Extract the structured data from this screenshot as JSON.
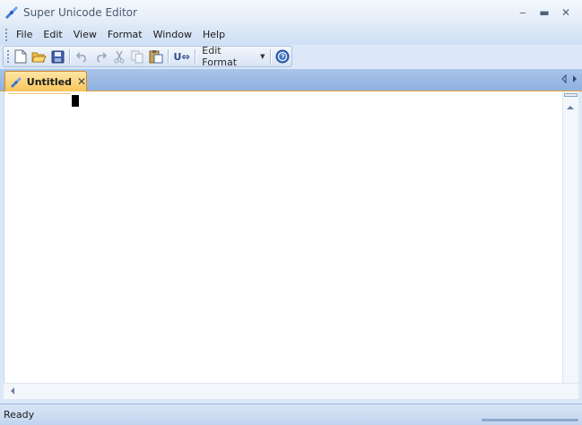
{
  "window": {
    "title": "Super Unicode Editor",
    "minimize_glyph": "‒",
    "maximize_glyph": "▬",
    "close_glyph": "✕"
  },
  "menu": {
    "items": [
      "File",
      "Edit",
      "View",
      "Format",
      "Window",
      "Help"
    ]
  },
  "toolbar": {
    "buttons": [
      "new-document-icon",
      "open-folder-icon",
      "save-icon",
      "undo-icon",
      "redo-icon",
      "cut-icon",
      "copy-icon",
      "paste-icon",
      "unicode-convert-icon",
      "help-icon"
    ],
    "unicode_label": "U⇔",
    "edit_format_label": "Edit Format",
    "edit_format_caret": "▼"
  },
  "tabs": {
    "active_label": "Untitled",
    "close_glyph": "✕"
  },
  "status": {
    "text": "Ready"
  },
  "colors": {
    "tab_active": "#f9c55a",
    "tab_strip": "#8fb1e0",
    "accent_orange": "#e8a33c"
  }
}
